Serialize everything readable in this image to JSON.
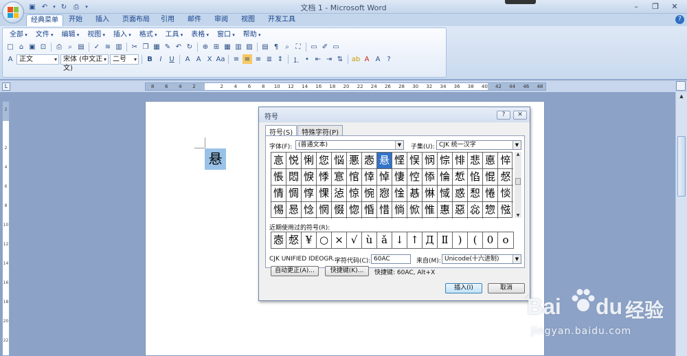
{
  "app": {
    "window_title": "文档 1 - Microsoft Word"
  },
  "ribbon_tabs": [
    "经典菜单",
    "开始",
    "插入",
    "页面布局",
    "引用",
    "邮件",
    "审阅",
    "视图",
    "开发工具"
  ],
  "classic_menu": [
    "全部",
    "文件",
    "编辑",
    "视图",
    "插入",
    "格式",
    "工具",
    "表格",
    "窗口",
    "帮助"
  ],
  "format_bar": {
    "style": "正文",
    "font": "宋体 (中文正文)",
    "size": "二号"
  },
  "ruler_numbers": [
    "8",
    "6",
    "4",
    "2",
    "",
    "2",
    "4",
    "6",
    "8",
    "10",
    "12",
    "14",
    "16",
    "18",
    "20",
    "22",
    "24",
    "26",
    "28",
    "30",
    "32",
    "34",
    "36",
    "38",
    "40",
    "42",
    "44",
    "46",
    "48"
  ],
  "document": {
    "selected_char": "悬"
  },
  "dialog": {
    "title": "符号",
    "help": "?",
    "close": "✕",
    "tabs": [
      "符号(S)",
      "特殊字符(P)"
    ],
    "font_label": "字体(F):",
    "font_value": "(普通文本)",
    "subset_label": "子集(U):",
    "subset_value": "CJK 统一汉字",
    "symbols": [
      [
        "悥",
        "悦",
        "悧",
        "您",
        "悩",
        "悪",
        "悫",
        "悬",
        "悭",
        "悮",
        "悯",
        "悰",
        "悱",
        "悲",
        "悳",
        "悴"
      ],
      [
        "悵",
        "悶",
        "悷",
        "悸",
        "悹",
        "悺",
        "悻",
        "悼",
        "悽",
        "悾",
        "悿",
        "惀",
        "惁",
        "惂",
        "惃",
        "惄"
      ],
      [
        "情",
        "惆",
        "惇",
        "惈",
        "惉",
        "惊",
        "惋",
        "惌",
        "惍",
        "惎",
        "惏",
        "惐",
        "惑",
        "惒",
        "惓",
        "惔"
      ],
      [
        "惕",
        "惖",
        "惗",
        "惘",
        "惙",
        "惚",
        "惛",
        "惜",
        "惝",
        "惞",
        "惟",
        "惠",
        "惡",
        "惢",
        "惣",
        "惤"
      ]
    ],
    "selected_symbol": "悬",
    "recent_label": "近期使用过的符号(R):",
    "recent_symbols": [
      "悫",
      "惄",
      "¥",
      "○",
      "×",
      "√",
      "ù",
      "ǎ",
      "↓",
      "↑",
      "Д",
      "Ⅱ",
      ")",
      "(",
      "0",
      "o"
    ],
    "char_name": "CJK UNIFIED IDEOGR...",
    "char_code_label": "字符代码(C):",
    "char_code": "60AC",
    "from_label": "来自(M):",
    "from_value": "Unicode(十六进制)",
    "autocorrect_button": "自动更正(A)...",
    "shortcut_button": "快捷键(K)...",
    "shortcut_text": "快捷键: 60AC, Alt+X",
    "insert_button": "插入(I)",
    "cancel_button": "取消"
  },
  "watermark": {
    "brand": "Bai",
    "brand2": "du",
    "cn": "经验",
    "url": "jingyan.baidu.com"
  },
  "colors": {
    "selection": "#3173c8",
    "office_blue": "#15428b"
  }
}
